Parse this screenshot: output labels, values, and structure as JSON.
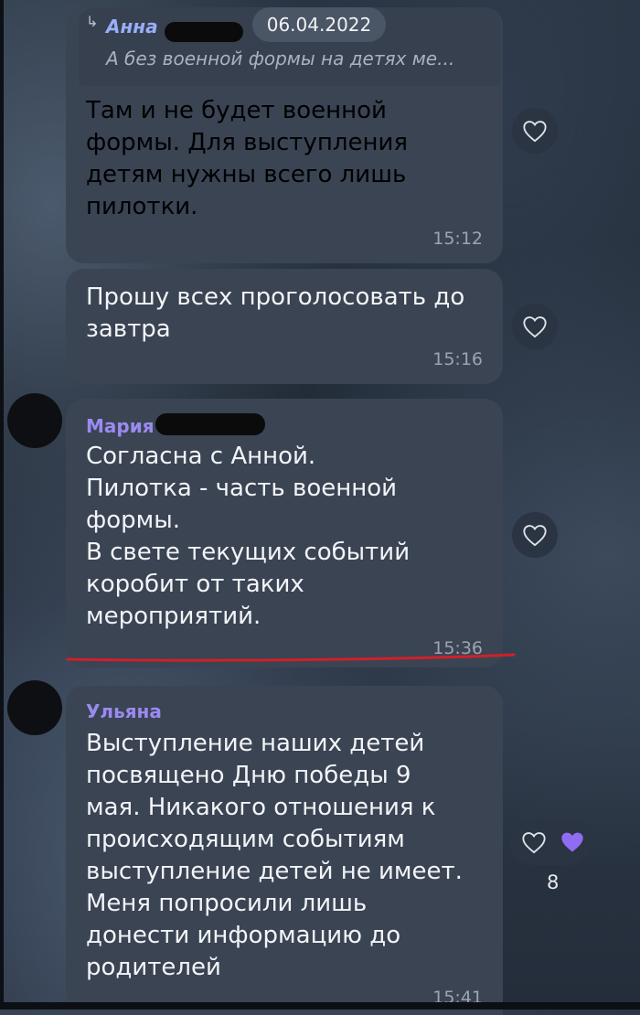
{
  "reply": {
    "arrow": "↳",
    "name": "Анна",
    "preview": "А без военной формы на детях ме...",
    "date": "06.04.2022"
  },
  "messages": [
    {
      "text": "Там и не будет военной\nформы. Для выступления\nдетям нужны всего лишь\nпилотки.",
      "time": "15:12"
    },
    {
      "text": "Прошу всех проголосовать до\nзавтра",
      "time": "15:16"
    },
    {
      "sender": "Мария",
      "text": "Согласна с Анной.\nПилотка - часть военной\nформы.\nВ свете текущих событий\nкоробит от таких\nмероприятий.",
      "time": "15:36"
    },
    {
      "sender": "Ульяна",
      "text": "Выступление наших детей\nпосвящено Дню победы 9\nмая. Никакого отношения к\nпроисходящим событиям\nвыступление детей не имеет.\nМеня попросили лишь\nдонести информацию до\nродителей",
      "time": "15:41",
      "reactions": {
        "count": "8"
      }
    }
  ],
  "colors": {
    "bubble": "#3a4453",
    "sender_accent": "#9b8af0",
    "reply_name": "#9aaef9",
    "heart_filled": "#8f6cf2",
    "underline": "#d0202a"
  },
  "icons": {
    "reaction": "heart-outline-icon",
    "reaction_active": "heart-filled-icon"
  }
}
